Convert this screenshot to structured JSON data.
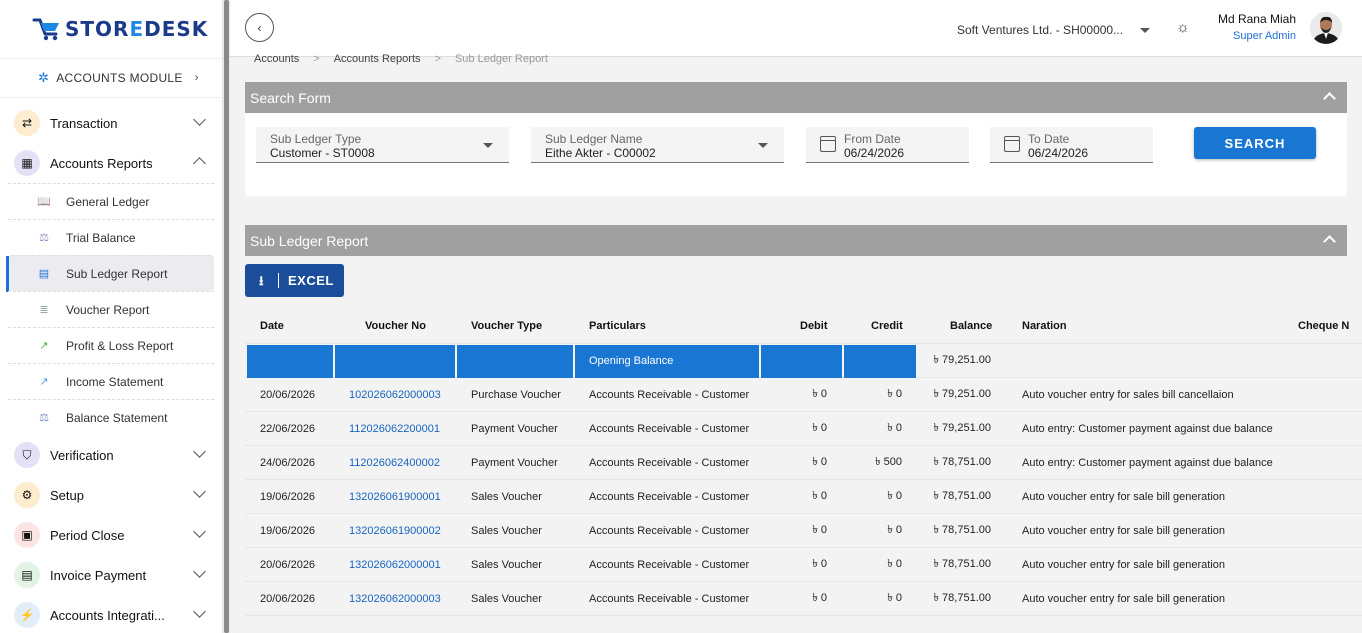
{
  "brand": {
    "name_a": "STOR",
    "name_o": "E",
    "name_b": "DESK"
  },
  "module": {
    "label": "ACCOUNTS MODULE"
  },
  "sidebar": {
    "items": [
      {
        "label": "Transaction",
        "icon": "transfer-icon",
        "color": "#fdeccd"
      },
      {
        "label": "Accounts Reports",
        "icon": "calculator-icon",
        "color": "#e4e1f7"
      }
    ],
    "sub_items": [
      {
        "label": "General Ledger",
        "icon": "book-icon"
      },
      {
        "label": "Trial Balance",
        "icon": "scale-icon"
      },
      {
        "label": "Sub Ledger Report",
        "icon": "notebook-icon"
      },
      {
        "label": "Voucher Report",
        "icon": "list-icon"
      },
      {
        "label": "Profit & Loss Report",
        "icon": "trend-up-icon"
      },
      {
        "label": "Income Statement",
        "icon": "trend-icon"
      },
      {
        "label": "Balance Statement",
        "icon": "balance-icon"
      }
    ],
    "bottom_items": [
      {
        "label": "Verification",
        "icon": "shield-icon",
        "color": "#e4e1f7"
      },
      {
        "label": "Setup",
        "icon": "gear-icon",
        "color": "#fdeccd"
      },
      {
        "label": "Period Close",
        "icon": "calendar-close-icon",
        "color": "#fde4e4"
      },
      {
        "label": "Invoice Payment",
        "icon": "invoice-icon",
        "color": "#e1f3e4"
      },
      {
        "label": "Accounts Integrati...",
        "icon": "plug-icon",
        "color": "#e1eef9"
      }
    ]
  },
  "topbar": {
    "company": "Soft Ventures Ltd. - SH00000...",
    "user_name": "Md Rana Miah",
    "user_role": "Super Admin"
  },
  "breadcrumb": {
    "items": [
      "Accounts",
      "Accounts Reports",
      "Sub Ledger Report"
    ]
  },
  "search_form": {
    "title": "Search Form",
    "sub_ledger_type": {
      "label": "Sub Ledger Type",
      "value": "Customer - ST0008"
    },
    "sub_ledger_name": {
      "label": "Sub Ledger Name",
      "value": "Eithe Akter - C00002"
    },
    "from_date": {
      "label": "From Date",
      "value": "06/24/2026"
    },
    "to_date": {
      "label": "To Date",
      "value": "06/24/2026"
    },
    "search_label": "SEARCH"
  },
  "report": {
    "title": "Sub Ledger Report",
    "excel_label": "EXCEL",
    "columns": [
      "Date",
      "Voucher No",
      "Voucher Type",
      "Particulars",
      "Debit",
      "Credit",
      "Balance",
      "Naration",
      "Cheque N"
    ],
    "opening": {
      "particulars": "Opening Balance",
      "balance": "৳ 79,251.00"
    },
    "rows": [
      {
        "date": "20/06/2026",
        "voucher_no": "102026062000003",
        "voucher_type": "Purchase Voucher",
        "particulars": "Accounts Receivable - Customer",
        "debit": "৳ 0",
        "credit": "৳ 0",
        "balance": "৳ 79,251.00",
        "naration": "Auto voucher entry for sales bill cancellaion"
      },
      {
        "date": "22/06/2026",
        "voucher_no": "112026062200001",
        "voucher_type": "Payment Voucher",
        "particulars": "Accounts Receivable - Customer",
        "debit": "৳ 0",
        "credit": "৳ 0",
        "balance": "৳ 79,251.00",
        "naration": "Auto entry: Customer payment against due balance"
      },
      {
        "date": "24/06/2026",
        "voucher_no": "112026062400002",
        "voucher_type": "Payment Voucher",
        "particulars": "Accounts Receivable - Customer",
        "debit": "৳ 0",
        "credit": "৳ 500",
        "balance": "৳ 78,751.00",
        "naration": "Auto entry: Customer payment against due balance"
      },
      {
        "date": "19/06/2026",
        "voucher_no": "132026061900001",
        "voucher_type": "Sales Voucher",
        "particulars": "Accounts Receivable - Customer",
        "debit": "৳ 0",
        "credit": "৳ 0",
        "balance": "৳ 78,751.00",
        "naration": "Auto voucher entry for sale bill generation"
      },
      {
        "date": "19/06/2026",
        "voucher_no": "132026061900002",
        "voucher_type": "Sales Voucher",
        "particulars": "Accounts Receivable - Customer",
        "debit": "৳ 0",
        "credit": "৳ 0",
        "balance": "৳ 78,751.00",
        "naration": "Auto voucher entry for sale bill generation"
      },
      {
        "date": "20/06/2026",
        "voucher_no": "132026062000001",
        "voucher_type": "Sales Voucher",
        "particulars": "Accounts Receivable - Customer",
        "debit": "৳ 0",
        "credit": "৳ 0",
        "balance": "৳ 78,751.00",
        "naration": "Auto voucher entry for sale bill generation"
      },
      {
        "date": "20/06/2026",
        "voucher_no": "132026062000003",
        "voucher_type": "Sales Voucher",
        "particulars": "Accounts Receivable - Customer",
        "debit": "৳ 0",
        "credit": "৳ 0",
        "balance": "৳ 78,751.00",
        "naration": "Auto voucher entry for sale bill generation"
      }
    ]
  },
  "colors": {
    "accent": "#1976d2",
    "excel": "#1b4d9b",
    "panel_header": "#a0a0a0",
    "link": "#1565c0"
  }
}
